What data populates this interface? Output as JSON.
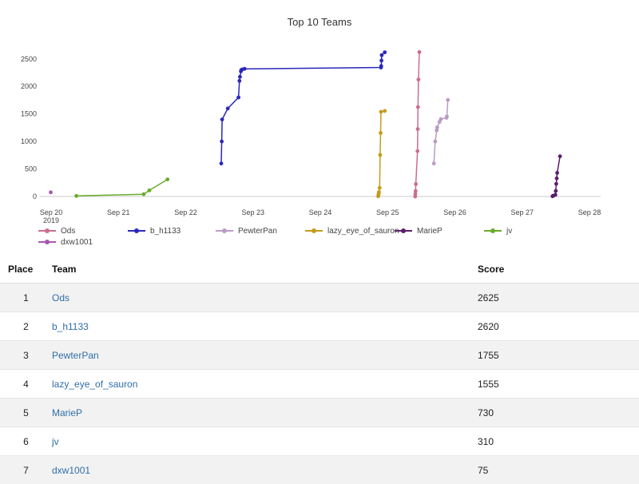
{
  "chart_data": {
    "type": "line",
    "title": "Top 10 Teams",
    "xlabel": "",
    "ylabel": "",
    "ylim": [
      0,
      2700
    ],
    "yticks": [
      0,
      500,
      1000,
      1500,
      2000,
      2500
    ],
    "x_tick_labels": [
      {
        "label": "Sep 20",
        "sub": "2019"
      },
      {
        "label": "Sep 21",
        "sub": ""
      },
      {
        "label": "Sep 22",
        "sub": ""
      },
      {
        "label": "Sep 23",
        "sub": ""
      },
      {
        "label": "Sep 24",
        "sub": ""
      },
      {
        "label": "Sep 25",
        "sub": ""
      },
      {
        "label": "Sep 26",
        "sub": ""
      },
      {
        "label": "Sep 27",
        "sub": ""
      },
      {
        "label": "Sep 28",
        "sub": ""
      }
    ],
    "xlim": [
      "2019-09-19 20:00",
      "2019-09-28 04:00"
    ],
    "legend_position": "bottom",
    "grid": false,
    "series": [
      {
        "name": "Ods",
        "color": "#cc6d91",
        "points": [
          [
            "2019-09-25 09:50",
            0
          ],
          [
            "2019-09-25 09:55",
            50
          ],
          [
            "2019-09-25 10:00",
            100
          ],
          [
            "2019-09-25 10:05",
            225
          ],
          [
            "2019-09-25 10:40",
            825
          ],
          [
            "2019-09-25 10:45",
            1225
          ],
          [
            "2019-09-25 10:50",
            1625
          ],
          [
            "2019-09-25 11:00",
            2125
          ],
          [
            "2019-09-25 11:20",
            2625
          ]
        ]
      },
      {
        "name": "b_h1133",
        "color": "#2b28b8",
        "points": [
          [
            "2019-09-22 12:40",
            600
          ],
          [
            "2019-09-22 12:50",
            1000
          ],
          [
            "2019-09-22 13:00",
            1400
          ],
          [
            "2019-09-22 15:00",
            1600
          ],
          [
            "2019-09-22 18:50",
            1800
          ],
          [
            "2019-09-22 19:10",
            2100
          ],
          [
            "2019-09-22 19:20",
            2175
          ],
          [
            "2019-09-22 19:40",
            2275
          ],
          [
            "2019-09-22 19:50",
            2300
          ],
          [
            "2019-09-22 20:10",
            2310
          ],
          [
            "2019-09-22 21:00",
            2320
          ],
          [
            "2019-09-24 21:40",
            2345
          ],
          [
            "2019-09-24 21:45",
            2370
          ],
          [
            "2019-09-24 21:50",
            2470
          ],
          [
            "2019-09-24 21:55",
            2570
          ],
          [
            "2019-09-24 23:00",
            2620
          ]
        ]
      },
      {
        "name": "PewterPan",
        "color": "#b99cc3",
        "points": [
          [
            "2019-09-25 16:30",
            600
          ],
          [
            "2019-09-25 17:00",
            1000
          ],
          [
            "2019-09-25 17:30",
            1200
          ],
          [
            "2019-09-25 17:40",
            1255
          ],
          [
            "2019-09-25 18:30",
            1355
          ],
          [
            "2019-09-25 19:00",
            1405
          ],
          [
            "2019-09-25 21:00",
            1430
          ],
          [
            "2019-09-25 21:10",
            1455
          ],
          [
            "2019-09-25 21:30",
            1755
          ]
        ]
      },
      {
        "name": "lazy_eye_of_sauron",
        "color": "#c49c1c",
        "points": [
          [
            "2019-09-24 20:40",
            5
          ],
          [
            "2019-09-24 20:45",
            30
          ],
          [
            "2019-09-24 20:50",
            55
          ],
          [
            "2019-09-24 20:55",
            80
          ],
          [
            "2019-09-24 21:10",
            155
          ],
          [
            "2019-09-24 21:20",
            755
          ],
          [
            "2019-09-24 21:30",
            1155
          ],
          [
            "2019-09-24 21:40",
            1540
          ],
          [
            "2019-09-24 23:00",
            1555
          ]
        ]
      },
      {
        "name": "MarieP",
        "color": "#5a1e6c",
        "points": [
          [
            "2019-09-27 10:50",
            5
          ],
          [
            "2019-09-27 11:00",
            10
          ],
          [
            "2019-09-27 11:10",
            15
          ],
          [
            "2019-09-27 11:50",
            30
          ],
          [
            "2019-09-27 12:00",
            100
          ],
          [
            "2019-09-27 12:10",
            230
          ],
          [
            "2019-09-27 12:20",
            330
          ],
          [
            "2019-09-27 12:30",
            430
          ],
          [
            "2019-09-27 13:30",
            730
          ]
        ]
      },
      {
        "name": "jv",
        "color": "#6aab2a",
        "points": [
          [
            "2019-09-20 09:00",
            10
          ],
          [
            "2019-09-21 09:00",
            40
          ],
          [
            "2019-09-21 11:00",
            110
          ],
          [
            "2019-09-21 17:30",
            310
          ]
        ]
      },
      {
        "name": "dxw1001",
        "color": "#a756b0",
        "points": [
          [
            "2019-09-19 23:50",
            75
          ]
        ]
      }
    ]
  },
  "table": {
    "headers": {
      "place": "Place",
      "team": "Team",
      "score": "Score"
    },
    "rows": [
      {
        "place": "1",
        "team": "Ods",
        "score": "2625"
      },
      {
        "place": "2",
        "team": "b_h1133",
        "score": "2620"
      },
      {
        "place": "3",
        "team": "PewterPan",
        "score": "1755"
      },
      {
        "place": "4",
        "team": "lazy_eye_of_sauron",
        "score": "1555"
      },
      {
        "place": "5",
        "team": "MarieP",
        "score": "730"
      },
      {
        "place": "6",
        "team": "jv",
        "score": "310"
      },
      {
        "place": "7",
        "team": "dxw1001",
        "score": "75"
      }
    ]
  }
}
